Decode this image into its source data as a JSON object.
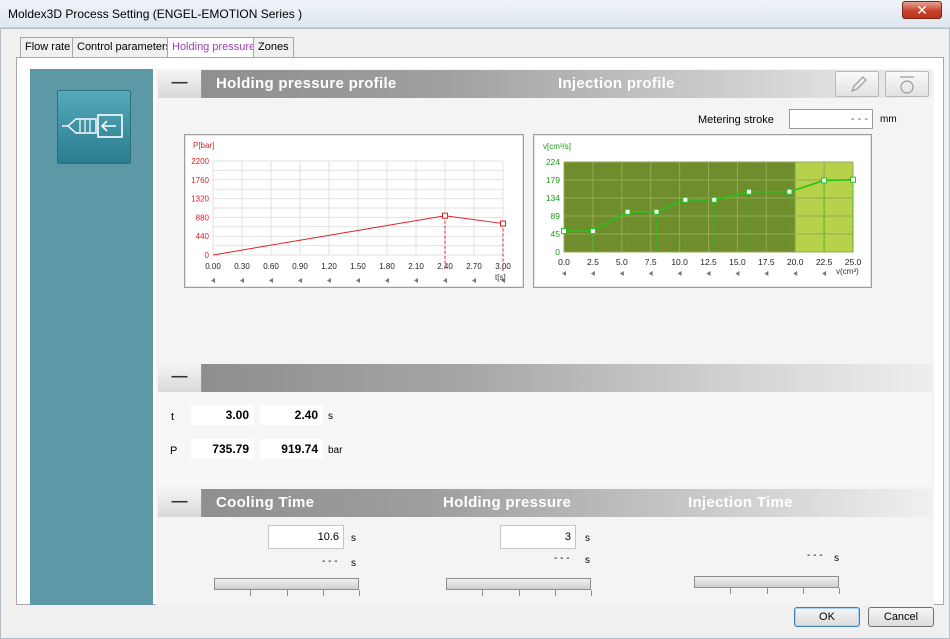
{
  "window": {
    "title": "Moldex3D Process Setting (ENGEL-EMOTION Series )",
    "close": "✕"
  },
  "tabs": [
    "Flow rate",
    "Control parameters",
    "Holding pressure",
    "Zones"
  ],
  "sections": {
    "profile_collapse": "—",
    "holding_profile_title": "Holding pressure profile",
    "injection_profile_title": "Injection profile",
    "points_collapse": "—",
    "time_collapse": "—",
    "cooling_time_title": "Cooling Time",
    "holding_pressure_title": "Holding pressure",
    "injection_time_title": "Injection Time"
  },
  "metering": {
    "label": "Metering stroke",
    "value": "- - -",
    "unit": "mm"
  },
  "holding_chart": {
    "type": "line",
    "ylabel": "P[bar]",
    "xlabel": "t[s]",
    "y_ticks": [
      "2200",
      "1760",
      "1320",
      "880",
      "440",
      "0"
    ],
    "x_ticks": [
      "0.00",
      "0.30",
      "0.60",
      "0.90",
      "1.20",
      "1.50",
      "1.80",
      "2.10",
      "2.40",
      "2.70",
      "3.00"
    ],
    "ylim": [
      0,
      2200
    ],
    "xlim": [
      0,
      3.0
    ],
    "color": "#e02020"
  },
  "injection_chart": {
    "type": "line",
    "ylabel": "v[cm³/s]",
    "xlabel": "v(cm³)",
    "y_ticks": [
      "224",
      "179",
      "134",
      "89",
      "45",
      "0"
    ],
    "x_ticks": [
      "0.0",
      "2.5",
      "5.0",
      "7.5",
      "10.0",
      "12.5",
      "15.0",
      "17.5",
      "20.0",
      "22.5",
      "25.0"
    ],
    "ylim": [
      0,
      224
    ],
    "xlim": [
      0,
      25
    ],
    "color": "#22c41d",
    "dark_fill": "#6f8d2c",
    "light_fill": "#b7d14a",
    "light_from": 20.0
  },
  "chart_data": [
    {
      "type": "line",
      "title": "Holding pressure profile",
      "xlabel": "t[s]",
      "ylabel": "P[bar]",
      "xlim": [
        0,
        3.0
      ],
      "ylim": [
        0,
        2200
      ],
      "x": [
        0,
        2.4,
        3.0
      ],
      "y": [
        0,
        919.74,
        735.79
      ],
      "grid": true
    },
    {
      "type": "line",
      "title": "Injection profile",
      "xlabel": "v(cm³)",
      "ylabel": "v[cm³/s]",
      "xlim": [
        0,
        25
      ],
      "ylim": [
        0,
        224
      ],
      "x": [
        0,
        2.5,
        5.5,
        8.0,
        10.5,
        13.0,
        16.0,
        19.5,
        22.5,
        25.0
      ],
      "y": [
        52,
        52,
        100,
        100,
        130,
        130,
        150,
        150,
        178,
        180
      ],
      "grid": true
    }
  ],
  "points": {
    "t_label": "t",
    "p_label": "P",
    "t_values": [
      "3.00",
      "2.40"
    ],
    "t_unit": "s",
    "p_values": [
      "735.79",
      "919.74"
    ],
    "p_unit": "bar"
  },
  "timing": {
    "cooling_value": "10.6",
    "cooling_unit": "s",
    "cooling_sub": "- - -",
    "cooling_sub_unit": "s",
    "holding_value": "3",
    "holding_unit": "s",
    "holding_sub": "- - -",
    "holding_sub_unit": "s",
    "injection_sub": "- - -",
    "injection_sub_unit": "s"
  },
  "buttons": {
    "ok": "OK",
    "cancel": "Cancel"
  }
}
